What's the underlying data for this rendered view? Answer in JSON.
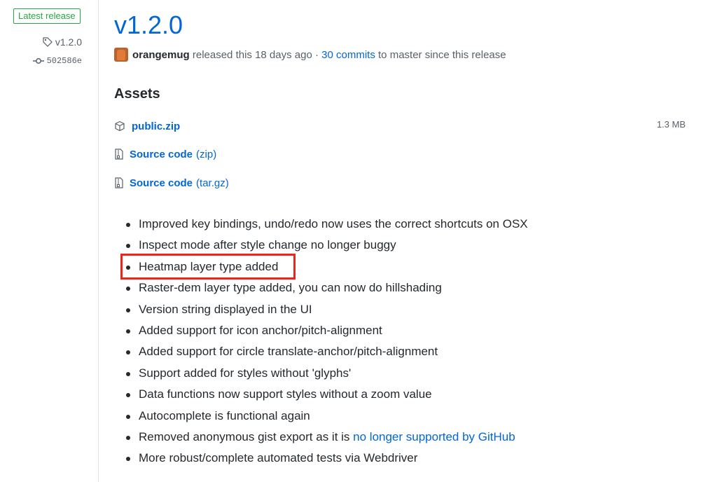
{
  "sidebar": {
    "badge": "Latest release",
    "tag": "v1.2.0",
    "commit": "502586e"
  },
  "release": {
    "title": "v1.2.0",
    "author": "orangemug",
    "released_text": "released this 18 days ago ·",
    "commits_link": "30 commits",
    "commits_suffix": "to master since this release"
  },
  "assets": {
    "heading": "Assets",
    "items": [
      {
        "name": "public.zip",
        "ext": "",
        "size": "1.3 MB",
        "icon": "package-icon"
      },
      {
        "name": "Source code",
        "ext": "(zip)",
        "icon": "file-zip-icon"
      },
      {
        "name": "Source code",
        "ext": "(tar.gz)",
        "icon": "file-zip-icon"
      }
    ]
  },
  "notes": [
    "Improved key bindings, undo/redo now uses the correct shortcuts on OSX",
    "Inspect mode after style change no longer buggy",
    "Heatmap layer type added",
    "Raster-dem layer type added, you can now do hillshading",
    "Version string displayed in the UI",
    "Added support for icon anchor/pitch-alignment",
    "Added support for circle translate-anchor/pitch-alignment",
    "Support added for styles without 'glyphs'",
    "Data functions now support styles without a zoom value",
    "Autocomplete is functional again",
    "Removed anonymous gist export as it is",
    "More robust/complete automated tests via Webdriver"
  ],
  "notes_link": "no longer supported by GitHub",
  "colors": {
    "link": "#0366d6",
    "badge": "#28a745",
    "highlight": "#e8261b"
  }
}
